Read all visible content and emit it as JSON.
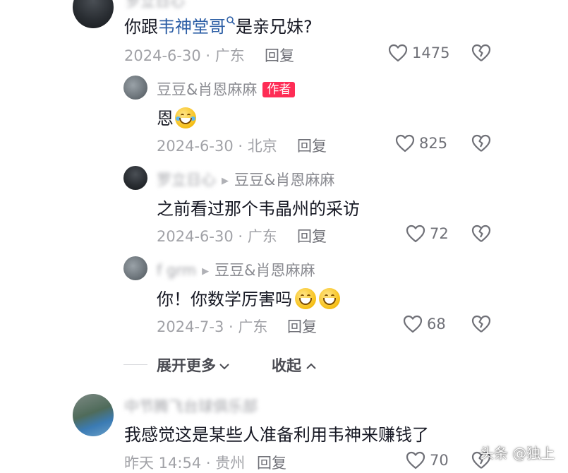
{
  "comments": [
    {
      "id": "c1",
      "text_prefix": "你跟",
      "link": "韦神堂哥",
      "text_suffix": "是亲兄妹?",
      "date_location": "2024-6-30 · 广东",
      "reply_label": "回复",
      "likes": "1475"
    },
    {
      "id": "r1",
      "author": "豆豆&肖恩麻麻",
      "author_tag": "作者",
      "text": "恩",
      "date_location": "2024-6-30 · 北京",
      "reply_label": "回复",
      "likes": "825"
    },
    {
      "id": "r2",
      "author": "罗立日心",
      "reply_to": "豆豆&肖恩麻麻",
      "text": "之前看过那个韦晶州的采访",
      "date_location": "2024-6-30 · 广东",
      "reply_label": "回复",
      "likes": "72"
    },
    {
      "id": "r3",
      "author": "f grm",
      "reply_to": "豆豆&肖恩麻麻",
      "text": "你！你数学厉害吗",
      "date_location": "2024-7-3 · 广东",
      "reply_label": "回复",
      "likes": "68"
    },
    {
      "id": "c2",
      "author": "中节腾飞台球俱乐部",
      "text": "我感觉这是某些人准备利用韦神来赚钱了",
      "date_location": "昨天 14:54 · 贵州",
      "reply_label": "回复",
      "likes": "70"
    }
  ],
  "thread_controls": {
    "expand_more": "展开更多",
    "collapse": "收起"
  },
  "watermark": "头条 @独上",
  "top_author_partial": "罗立日心",
  "colors": {
    "tag_bg": "#fe2c55",
    "link": "#2d5fa6",
    "meta": "#a1a2a7"
  },
  "icons": [
    "heart-outline-icon",
    "broken-heart-icon",
    "search-icon",
    "chevron-down-icon",
    "chevron-up-icon",
    "play-triangle-icon"
  ]
}
